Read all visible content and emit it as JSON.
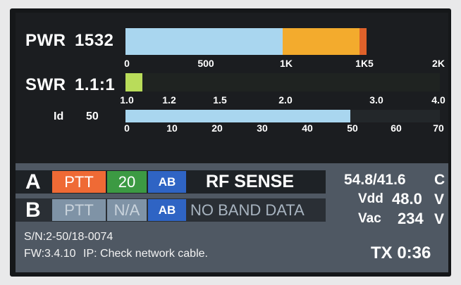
{
  "meters": {
    "pwr": {
      "label": "PWR",
      "value": "1532",
      "scale": [
        "0",
        "500",
        "1K",
        "1K5",
        "2K"
      ],
      "reading_w": 1532,
      "scale_max_w": 2000
    },
    "swr": {
      "label": "SWR",
      "value": "1.1:1",
      "scale": [
        "1.0",
        "1.2",
        "1.5",
        "2.0",
        "3.0",
        "4.0"
      ]
    },
    "id": {
      "label": "Id",
      "value": "50",
      "scale": [
        "0",
        "10",
        "20",
        "30",
        "40",
        "50",
        "60",
        "70"
      ],
      "reading": 50,
      "scale_max": 70
    }
  },
  "radio_a": {
    "letter": "A",
    "ptt": "PTT",
    "band": "20",
    "ab": "AB",
    "status": "RF SENSE"
  },
  "radio_b": {
    "letter": "B",
    "ptt": "PTT",
    "band": "N/A",
    "ab": "AB",
    "status": "NO BAND DATA"
  },
  "stats": {
    "temp": "54.8/41.6",
    "temp_unit": "C",
    "vdd_label": "Vdd",
    "vdd_value": "48.0",
    "vdd_unit": "V",
    "vac_label": "Vac",
    "vac_value": "234",
    "vac_unit": "V"
  },
  "footer": {
    "serial": "S/N:2-50/18-0074",
    "firmware": "FW:3.4.10",
    "ip": "IP: Check network cable.",
    "tx_time": "TX 0:36"
  },
  "colors": {
    "bar_blue": "#a9d6ef",
    "bar_orange": "#f3ab2d",
    "bar_peak": "#e0622a",
    "swr_green": "#b9dc5a",
    "ptt_orange": "#ef6a35",
    "band_green": "#3c9a43",
    "ab_blue": "#2f64c4",
    "panel": "#4f5863"
  }
}
